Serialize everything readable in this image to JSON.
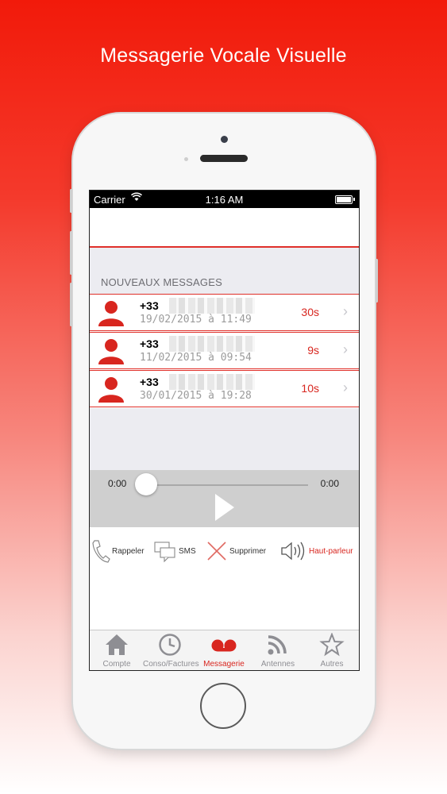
{
  "headline": "Messagerie Vocale Visuelle",
  "status_bar": {
    "carrier": "Carrier",
    "time": "1:16 AM"
  },
  "section_title": "NOUVEAUX MESSAGES",
  "messages": [
    {
      "number": "+33",
      "date": "19/02/2015 à 11:49",
      "duration": "30s"
    },
    {
      "number": "+33",
      "date": "11/02/2015 à 09:54",
      "duration": "9s"
    },
    {
      "number": "+33",
      "date": "30/01/2015 à 19:28",
      "duration": "10s"
    }
  ],
  "player": {
    "elapsed": "0:00",
    "total": "0:00",
    "progress": 0
  },
  "actions": {
    "callback": "Rappeler",
    "sms": "SMS",
    "delete": "Supprimer",
    "speaker": "Haut-parleur"
  },
  "tabs": [
    {
      "label": "Compte",
      "icon": "home-icon"
    },
    {
      "label": "Conso/Factures",
      "icon": "clock-icon"
    },
    {
      "label": "Messagerie",
      "icon": "voicemail-icon",
      "active": true
    },
    {
      "label": "Antennes",
      "icon": "signal-icon"
    },
    {
      "label": "Autres",
      "icon": "star-icon"
    }
  ],
  "colors": {
    "accent": "#d8261f",
    "background_top": "#f21a0a",
    "tab_inactive": "#8e8e93"
  }
}
